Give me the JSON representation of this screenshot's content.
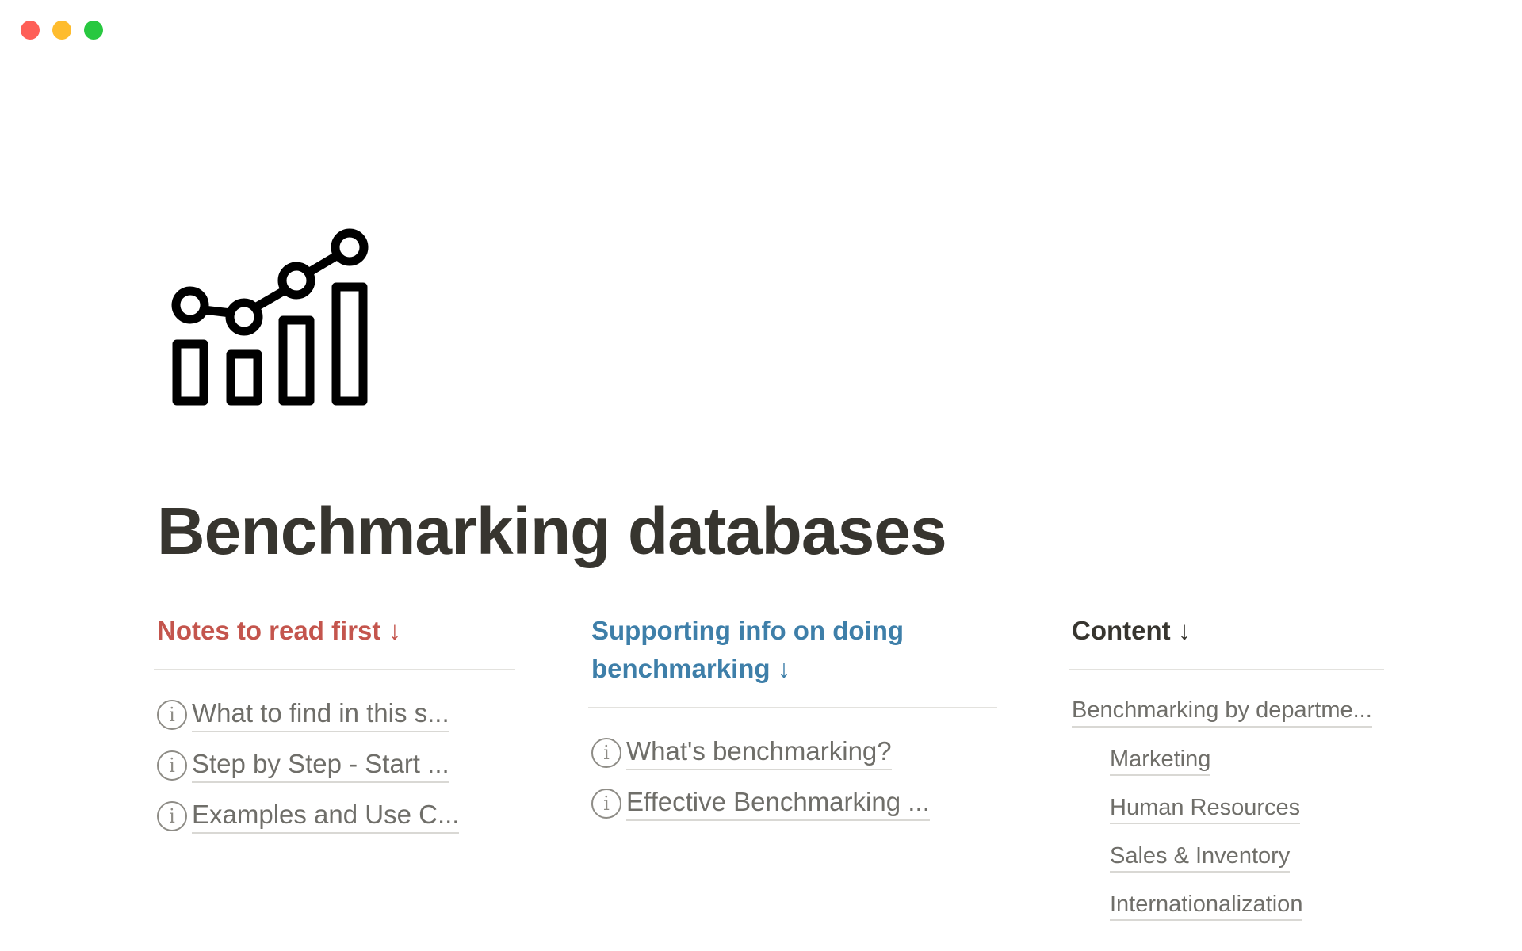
{
  "window": {
    "controls": [
      "close",
      "minimize",
      "zoom"
    ]
  },
  "page": {
    "icon": "chart-growth-icon",
    "title": "Benchmarking databases"
  },
  "columns": {
    "notes": {
      "heading": "Notes to read first",
      "arrow": "↓",
      "color": "#c4554d",
      "links": [
        "What to find in this s...",
        "Step by Step - Start ...",
        "Examples and Use C..."
      ]
    },
    "supporting": {
      "heading_line1": "Supporting info on doing",
      "heading_line2": "benchmarking",
      "arrow": "↓",
      "color": "#3e7fa9",
      "links": [
        "What's benchmarking?",
        "Effective Benchmarking ..."
      ]
    },
    "content": {
      "heading": "Content",
      "arrow": "↓",
      "main_link": "Benchmarking by departme...",
      "sub_links": [
        "Marketing",
        "Human Resources",
        "Sales & Inventory",
        "Internationalization"
      ]
    }
  },
  "colors": {
    "close": "#fe5f57",
    "minimize": "#febc2e",
    "zoom": "#28c840",
    "text": "#37352f",
    "muted": "#6f6e69"
  }
}
